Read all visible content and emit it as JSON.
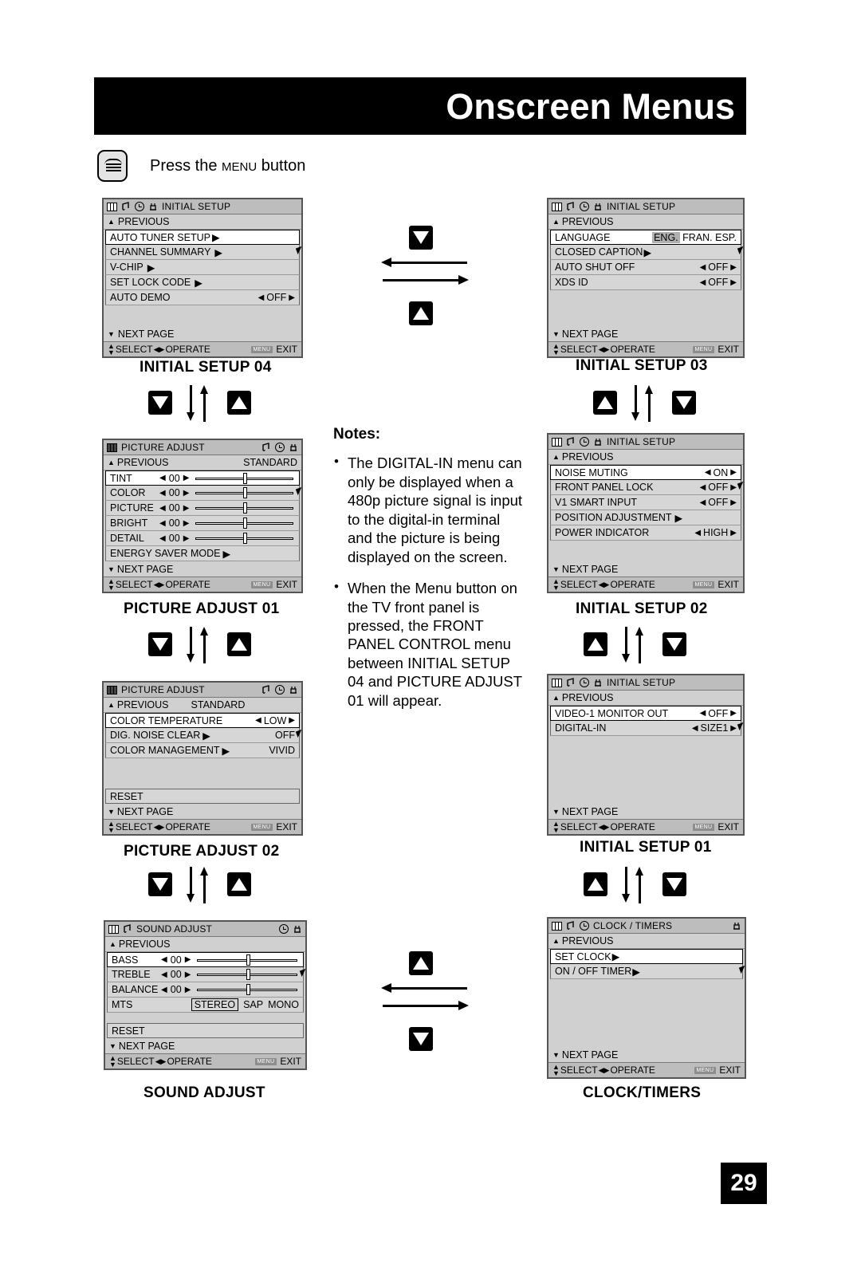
{
  "header": {
    "title": "Onscreen Menus"
  },
  "press_hint": {
    "prefix": "Press the ",
    "menu_word": "MENU",
    "suffix": " button"
  },
  "page_number": "29",
  "common": {
    "previous": "PREVIOUS",
    "next_page": "NEXT PAGE",
    "select": "SELECT",
    "operate": "OPERATE",
    "exit": "EXIT",
    "menu_chip": "MENU",
    "standard": "STANDARD",
    "reset": "RESET"
  },
  "panels": {
    "initial_setup_04": {
      "caption": "INITIAL SETUP 04",
      "head_title": "INITIAL SETUP",
      "rows": [
        {
          "label": "AUTO TUNER SETUP",
          "arrow": true,
          "value": ""
        },
        {
          "label": "CHANNEL SUMMARY",
          "arrow": true,
          "value": ""
        },
        {
          "label": "V-CHIP",
          "arrow": true,
          "value": ""
        },
        {
          "label": "SET LOCK CODE",
          "arrow": true,
          "value": ""
        },
        {
          "label": "AUTO DEMO",
          "arrow": false,
          "value": "OFF"
        }
      ]
    },
    "initial_setup_03": {
      "caption": "INITIAL SETUP 03",
      "head_title": "INITIAL SETUP",
      "rows": [
        {
          "label": "LANGUAGE",
          "arrow": false,
          "value": "",
          "lang": [
            "ENG.",
            "FRAN.",
            "ESP."
          ],
          "lang_selected": "ENG."
        },
        {
          "label": "CLOSED CAPTION",
          "arrow": true,
          "value": ""
        },
        {
          "label": "AUTO SHUT OFF",
          "arrow": false,
          "value": "OFF"
        },
        {
          "label": "XDS ID",
          "arrow": false,
          "value": "OFF"
        }
      ]
    },
    "picture_adjust_01": {
      "caption": "PICTURE ADJUST 01",
      "head_title": "PICTURE ADJUST",
      "preset": "STANDARD",
      "rows": [
        {
          "label": "TINT",
          "value": "00",
          "slider": true
        },
        {
          "label": "COLOR",
          "value": "00",
          "slider": true
        },
        {
          "label": "PICTURE",
          "value": "00",
          "slider": true
        },
        {
          "label": "BRIGHT",
          "value": "00",
          "slider": true
        },
        {
          "label": "DETAIL",
          "value": "00",
          "slider": true
        },
        {
          "label": "ENERGY SAVER MODE",
          "arrow": true,
          "slider": false,
          "value": ""
        }
      ]
    },
    "initial_setup_02": {
      "caption": "INITIAL SETUP 02",
      "head_title": "INITIAL SETUP",
      "rows": [
        {
          "label": "NOISE MUTING",
          "arrow": false,
          "value": "ON"
        },
        {
          "label": "FRONT PANEL LOCK",
          "arrow": false,
          "value": "OFF"
        },
        {
          "label": "V1 SMART INPUT",
          "arrow": false,
          "value": "OFF"
        },
        {
          "label": "POSITION ADJUSTMENT",
          "arrow": true,
          "value": ""
        },
        {
          "label": "POWER INDICATOR",
          "arrow": false,
          "value": "HIGH"
        }
      ]
    },
    "picture_adjust_02": {
      "caption": "PICTURE ADJUST 02",
      "head_title": "PICTURE ADJUST",
      "preset": "STANDARD",
      "rows": [
        {
          "label": "COLOR TEMPERATURE",
          "arrow": false,
          "value": "LOW",
          "stepper": true
        },
        {
          "label": "DIG. NOISE CLEAR",
          "arrow": true,
          "value": "OFF",
          "stepper": false
        },
        {
          "label": "COLOR MANAGEMENT",
          "arrow": true,
          "value": "VIVID",
          "stepper": false
        }
      ]
    },
    "initial_setup_01": {
      "caption": "INITIAL SETUP 01",
      "head_title": "INITIAL SETUP",
      "rows": [
        {
          "label": "VIDEO-1 MONITOR OUT",
          "arrow": false,
          "value": "OFF"
        },
        {
          "label": "DIGITAL-IN",
          "arrow": false,
          "value": "SIZE1"
        }
      ]
    },
    "sound_adjust": {
      "caption": "SOUND ADJUST",
      "head_title": "SOUND ADJUST",
      "rows": [
        {
          "label": "BASS",
          "value": "00",
          "slider": true
        },
        {
          "label": "TREBLE",
          "value": "00",
          "slider": true
        },
        {
          "label": "BALANCE",
          "value": "00",
          "slider": true
        }
      ],
      "mts": {
        "label": "MTS",
        "options": [
          "STEREO",
          "SAP",
          "MONO"
        ],
        "selected": "STEREO"
      }
    },
    "clock_timers": {
      "caption": "CLOCK/TIMERS",
      "head_title": "CLOCK / TIMERS",
      "rows": [
        {
          "label": "SET CLOCK",
          "arrow": true,
          "value": ""
        },
        {
          "label": "ON / OFF TIMER",
          "arrow": true,
          "value": ""
        }
      ]
    }
  },
  "notes": {
    "title": "Notes:",
    "items": [
      "The DIGITAL-IN menu can only be displayed when a 480p picture signal is input to the digital-in terminal and the picture is being displayed on the screen.",
      "When the Menu button on the TV front panel is pressed, the FRONT PANEL CONTROL menu between INITIAL SETUP 04 and PICTURE ADJUST 01 will appear."
    ]
  }
}
